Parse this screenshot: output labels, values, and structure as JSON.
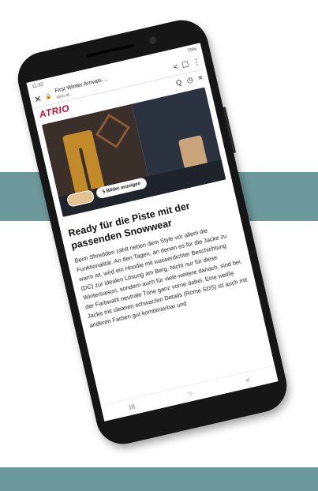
{
  "status": {
    "time": "11:32",
    "battery": "70%"
  },
  "browser": {
    "page_title": "First Winter Arrivals ...",
    "domain": "atrio.at",
    "close_label": "✕",
    "share_label": "<",
    "bookmark_label": "☐",
    "menu_label": "⋮"
  },
  "site": {
    "logo": "ATRIO",
    "search_label": "Q",
    "clock_label": "◷",
    "menu_label": "≡"
  },
  "hero": {
    "button_label": "5 Bilder anzeigen"
  },
  "article": {
    "headline": "Ready für die Piste mit der passenden Snowwear",
    "body": "Beim Shredden zählt neben dem Style vor allem die Funktionalität. An den Tagen, an denen es für die Jacke zu warm ist, wird ein Hoodie mit wasserdichter Beschichtung (DC) zur idealen Lösung am Berg. Nicht nur für diese Wintersaison, sondern auch für viele weitere danach, sind bei der Farbwahl neutrale Töne ganz vorne dabei. Eine weiße Jacke mit cleanen schwarzen Details (Rome SDS) ist auch mit anderen Farben gut kombinierbar und"
  },
  "navbar": {
    "recents": "III",
    "home": "○",
    "back": "<"
  },
  "colors": {
    "band": "#6e999c",
    "logo": "#c8102e",
    "phone": "#161616"
  }
}
